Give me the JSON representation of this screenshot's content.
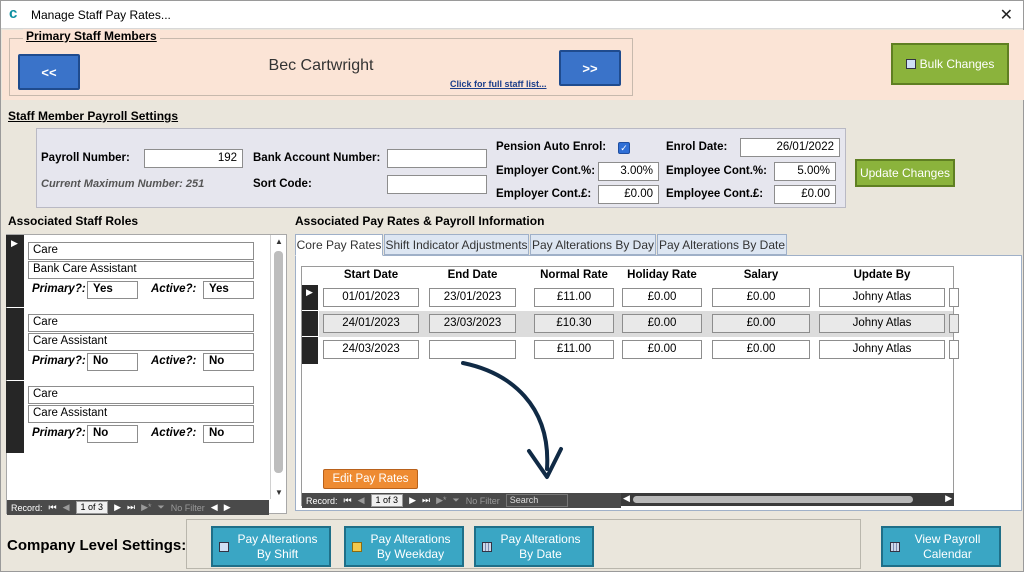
{
  "window": {
    "title": "Manage Staff Pay Rates...",
    "close_glyph": "✕"
  },
  "primary": {
    "group_label": "Primary Staff Members",
    "prev_label": "<<",
    "next_label": ">>",
    "staff_name": "Bec Cartwright",
    "full_list_link": "Click for full staff list...",
    "bulk_changes_label": "Bulk Changes"
  },
  "payroll": {
    "section_title": "Staff Member Payroll Settings",
    "payroll_number_label": "Payroll Number:",
    "payroll_number": "192",
    "current_max_note": "Current Maximum Number: 251",
    "bank_account_label": "Bank Account Number:",
    "bank_account_value": "",
    "sort_code_label": "Sort Code:",
    "sort_code_value": "",
    "pension_label": "Pension Auto Enrol:",
    "pension_checked": true,
    "employer_pct_label": "Employer Cont.%:",
    "employer_pct": "3.00%",
    "employer_gbp_label": "Employer Cont.£:",
    "employer_gbp": "£0.00",
    "enrol_date_label": "Enrol Date:",
    "enrol_date": "26/01/2022",
    "employee_pct_label": "Employee Cont.%:",
    "employee_pct": "5.00%",
    "employee_gbp_label": "Employee Cont.£:",
    "employee_gbp": "£0.00",
    "update_label": "Update Changes"
  },
  "roles": {
    "section_title": "Associated Staff Roles",
    "primary_label": "Primary?:",
    "active_label": "Active?:",
    "items": [
      {
        "role": "Care",
        "subrole": "Bank Care Assistant",
        "primary": "Yes",
        "active": "Yes"
      },
      {
        "role": "Care",
        "subrole": "Care Assistant",
        "primary": "No",
        "active": "No"
      },
      {
        "role": "Care",
        "subrole": "Care Assistant",
        "primary": "No",
        "active": "No"
      }
    ],
    "record_label": "Record:",
    "record_count": "1 of 3",
    "no_filter": "No Filter"
  },
  "payrates": {
    "section_title": "Associated Pay Rates & Payroll Information",
    "tabs": [
      "Core Pay Rates",
      "Shift Indicator Adjustments",
      "Pay Alterations By Day",
      "Pay Alterations By Date"
    ],
    "columns": [
      "Start Date",
      "End Date",
      "Normal Rate",
      "Holiday Rate",
      "Salary",
      "Update By"
    ],
    "rows": [
      {
        "start": "01/01/2023",
        "end": "23/01/2023",
        "normal": "£11.00",
        "holiday": "£0.00",
        "salary": "£0.00",
        "by": "Johny Atlas"
      },
      {
        "start": "24/01/2023",
        "end": "23/03/2023",
        "normal": "£10.30",
        "holiday": "£0.00",
        "salary": "£0.00",
        "by": "Johny Atlas"
      },
      {
        "start": "24/03/2023",
        "end": "",
        "normal": "£11.00",
        "holiday": "£0.00",
        "salary": "£0.00",
        "by": "Johny Atlas"
      }
    ],
    "edit_label": "Edit Pay Rates",
    "record_label": "Record:",
    "record_count": "1 of 3",
    "no_filter": "No Filter",
    "search_label": "Search"
  },
  "company": {
    "label": "Company Level Settings:",
    "btn_shift": "Pay Alterations By Shift",
    "btn_weekday": "Pay Alterations By Weekday",
    "btn_date": "Pay Alterations By Date",
    "btn_calendar": "View Payroll Calendar"
  },
  "colors": {
    "header_bg": "#fbe4d6",
    "nav_blue": "#3a73c9",
    "green": "#8bb33c",
    "orange": "#ee8b32",
    "teal": "#3aa6c4",
    "arrow": "#102a45"
  }
}
